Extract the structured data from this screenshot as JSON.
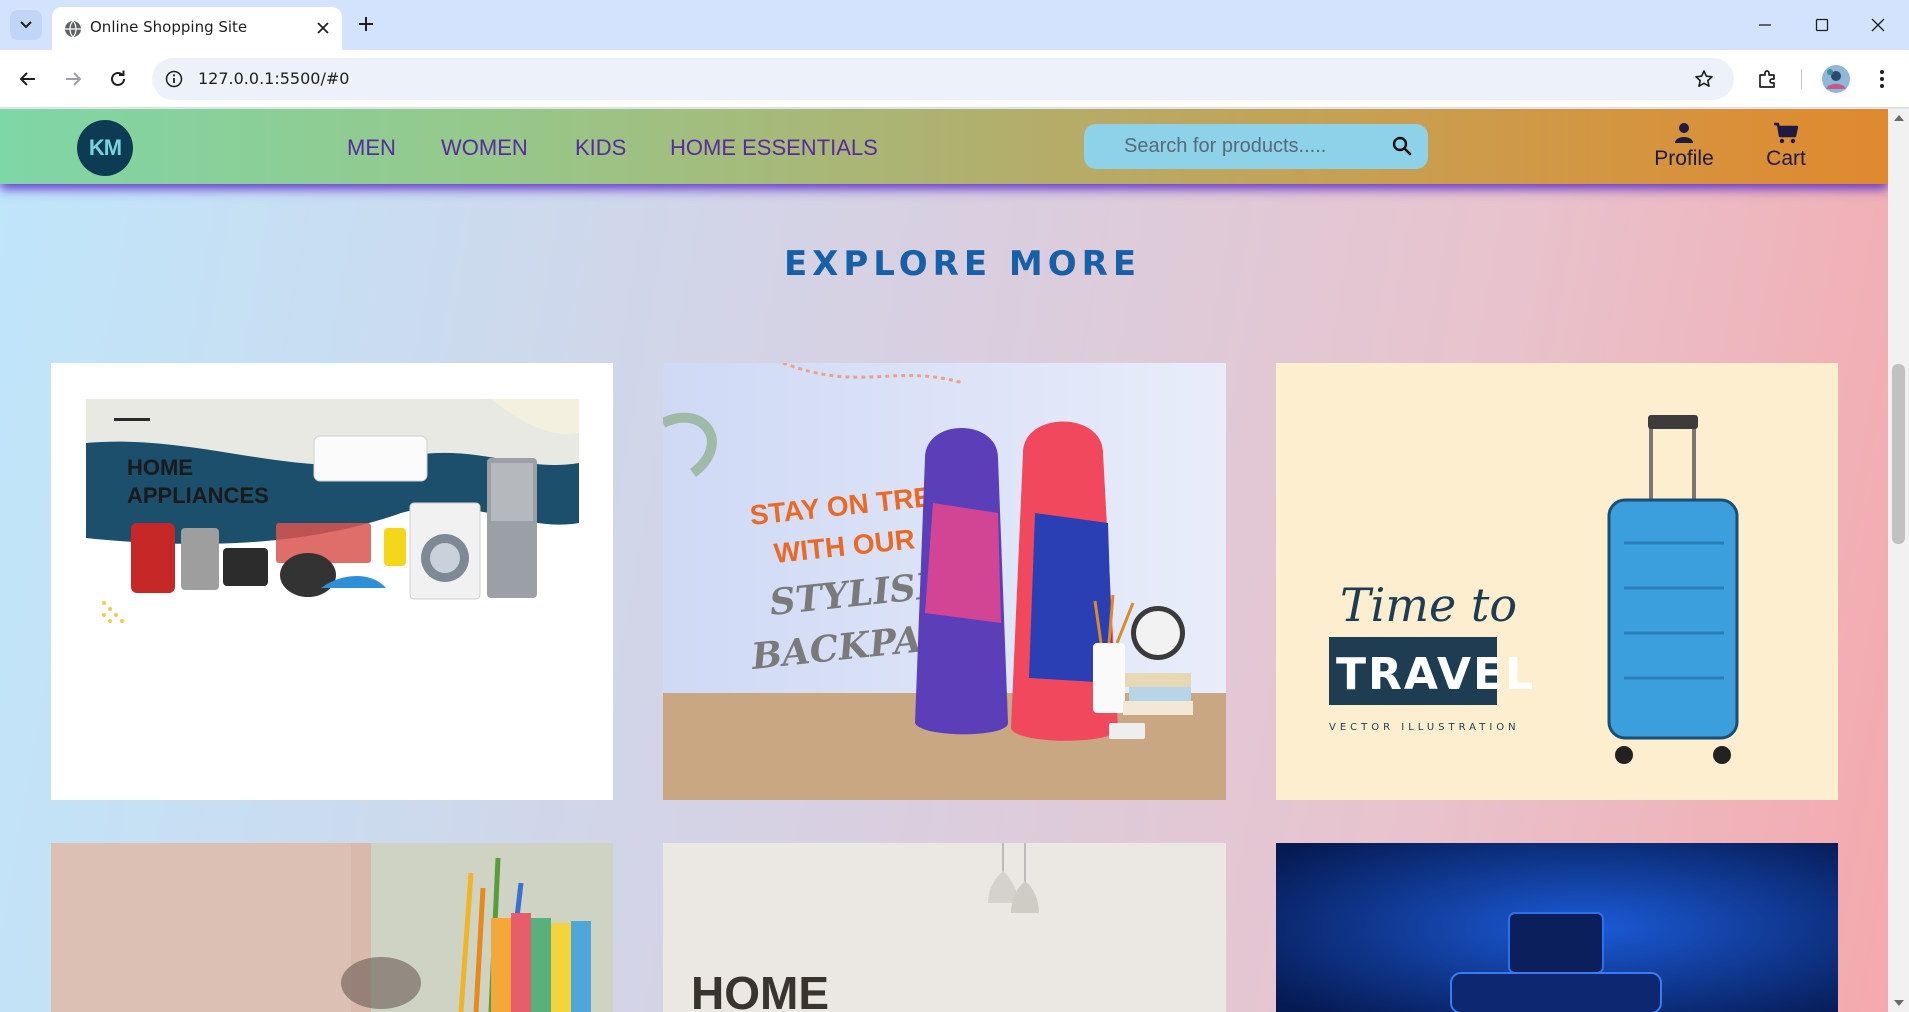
{
  "browser": {
    "tab_title": "Online Shopping Site",
    "url": "127.0.0.1:5500/#0"
  },
  "site": {
    "logo_text": "KM",
    "nav": [
      {
        "label": "MEN"
      },
      {
        "label": "WOMEN"
      },
      {
        "label": "KIDS"
      },
      {
        "label": "HOME ESSENTIALS"
      }
    ],
    "search_placeholder": "Search for products.....",
    "profile_label": "Profile",
    "cart_label": "Cart"
  },
  "section_title": "EXPLORE MORE",
  "cards": [
    {
      "lines": [
        "HOME",
        "APPLIANCES"
      ]
    },
    {
      "lines": [
        "STAY ON TREND",
        "WITH OUR",
        "STYLISH",
        "BACKPACKS"
      ]
    },
    {
      "lines": [
        "Time to",
        "TRAVEL",
        "VECTOR ILLUSTRATION"
      ]
    },
    {
      "lines": []
    },
    {
      "lines": [
        "HOME"
      ]
    },
    {
      "lines": []
    }
  ],
  "colors": {
    "accent_title": "#1760a8",
    "nav_link": "#5a2aa0",
    "search_bg": "#8ed2ea"
  }
}
